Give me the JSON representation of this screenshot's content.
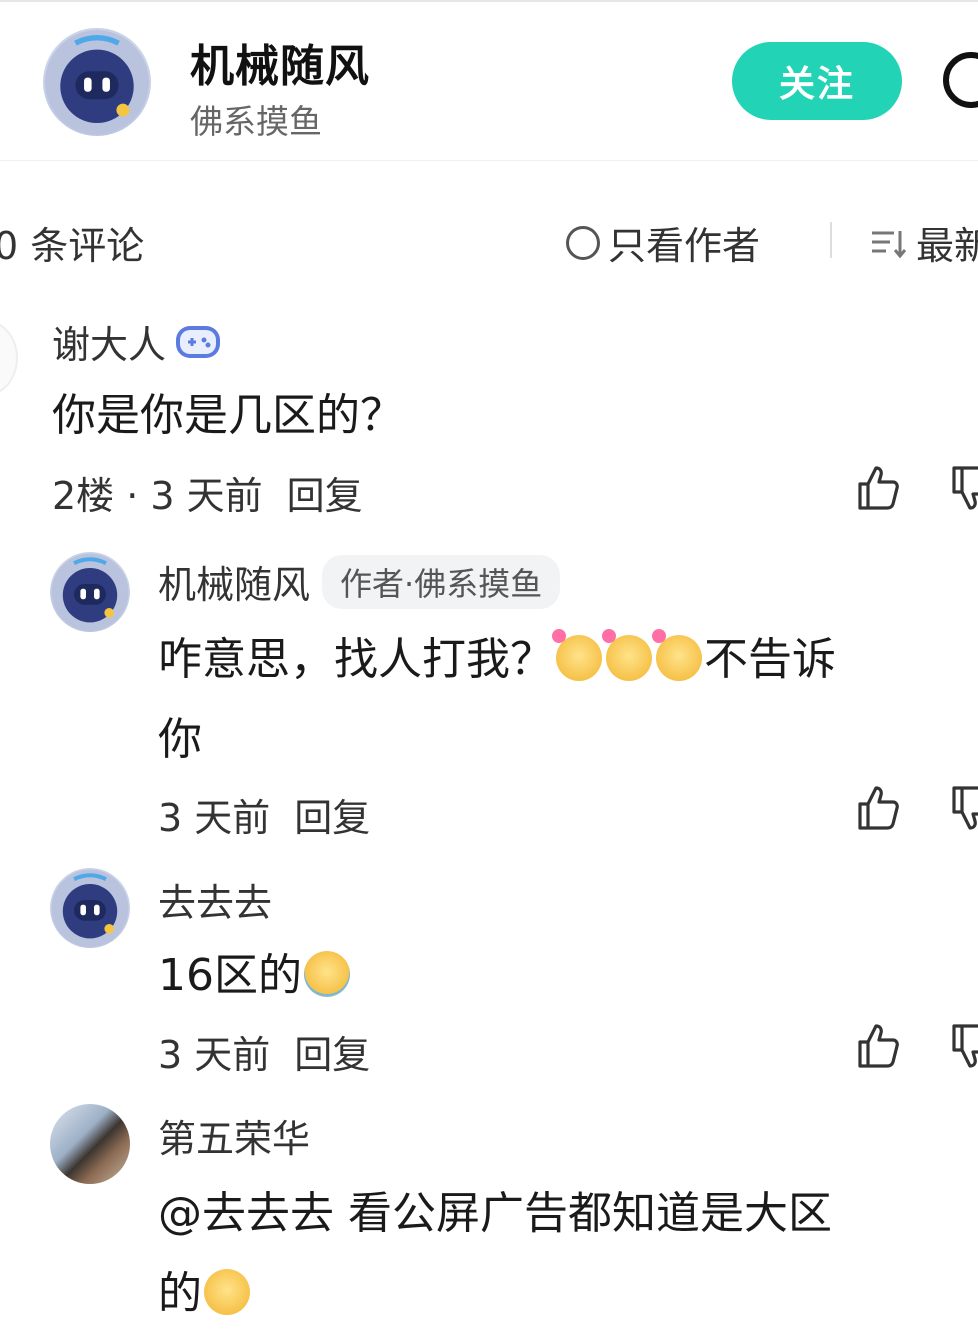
{
  "header": {
    "title": "机械随风",
    "subtitle": "佛系摸鱼",
    "follow_label": "关注"
  },
  "toolbar": {
    "comment_count": "0 条评论",
    "author_only_label": "只看作者",
    "sort_label": "最新"
  },
  "comments": [
    {
      "username": "谢大人",
      "text": "你是你是几区的？",
      "meta_floor_time": "2楼 · 3 天前",
      "reply_label": "回复"
    },
    {
      "username": "机械随风",
      "author_tag": "作者·佛系摸鱼",
      "text_before": "咋意思，找人打我？",
      "text_after": "不告诉",
      "text_wrap": "你",
      "meta_time": "3 天前",
      "reply_label": "回复"
    },
    {
      "username": "去去去",
      "text": "16区的",
      "meta_time": "3 天前",
      "reply_label": "回复"
    },
    {
      "username": "第五荣华",
      "text": "@去去去  看公屏广告都知道是大区",
      "text_wrap": "的"
    }
  ],
  "icons": {
    "game_badge": "gamepad-icon",
    "like": "thumbs-up-icon",
    "dislike": "thumbs-down-icon",
    "sort": "sort-icon",
    "emoji_grin": "grinning-heart-emoji",
    "emoji_cry": "crying-emoji"
  },
  "colors": {
    "accent": "#22d3b5",
    "text_primary": "#1a1a1a",
    "text_secondary": "#666666"
  }
}
